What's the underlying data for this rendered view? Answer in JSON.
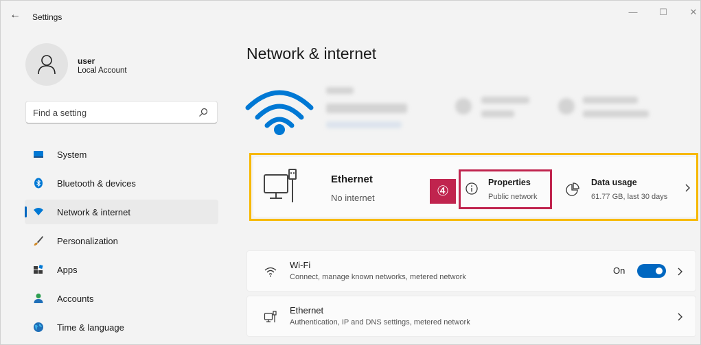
{
  "window": {
    "back_icon": "back-arrow-icon",
    "title": "Settings",
    "controls": [
      "minimize-icon",
      "maximize-icon",
      "close-icon"
    ]
  },
  "sidebar": {
    "user": {
      "name": "user",
      "account_type": "Local Account",
      "avatar_icon": "person-icon"
    },
    "search": {
      "placeholder": "Find a setting",
      "icon": "search-icon"
    },
    "items": [
      {
        "label": "System",
        "icon": "system-icon",
        "active": false
      },
      {
        "label": "Bluetooth & devices",
        "icon": "bluetooth-icon",
        "active": false
      },
      {
        "label": "Network & internet",
        "icon": "network-icon",
        "active": true
      },
      {
        "label": "Personalization",
        "icon": "brush-icon",
        "active": false
      },
      {
        "label": "Apps",
        "icon": "apps-icon",
        "active": false
      },
      {
        "label": "Accounts",
        "icon": "accounts-icon",
        "active": false
      },
      {
        "label": "Time & language",
        "icon": "globe-icon",
        "active": false
      }
    ]
  },
  "main": {
    "title": "Network & internet",
    "hero_icon": "wifi-large-icon",
    "ethernet_card": {
      "name": "Ethernet",
      "status": "No internet",
      "icon": "ethernet-large-icon",
      "step_number": "④",
      "properties": {
        "label": "Properties",
        "sub": "Public network",
        "icon": "info-icon"
      },
      "data_usage": {
        "label": "Data usage",
        "sub": "61.77 GB, last 30 days",
        "icon": "pie-chart-icon"
      }
    },
    "rows": [
      {
        "title": "Wi-Fi",
        "subtitle": "Connect, manage known networks, metered network",
        "icon": "wifi-icon",
        "toggle_label": "On",
        "toggle_on": true
      },
      {
        "title": "Ethernet",
        "subtitle": "Authentication, IP and DNS settings, metered network",
        "icon": "ethernet-icon"
      }
    ]
  },
  "colors": {
    "accent": "#0067c0",
    "highlight_yellow": "#f7b800",
    "highlight_red": "#c0244e",
    "wifi_blue": "#0078d4"
  }
}
